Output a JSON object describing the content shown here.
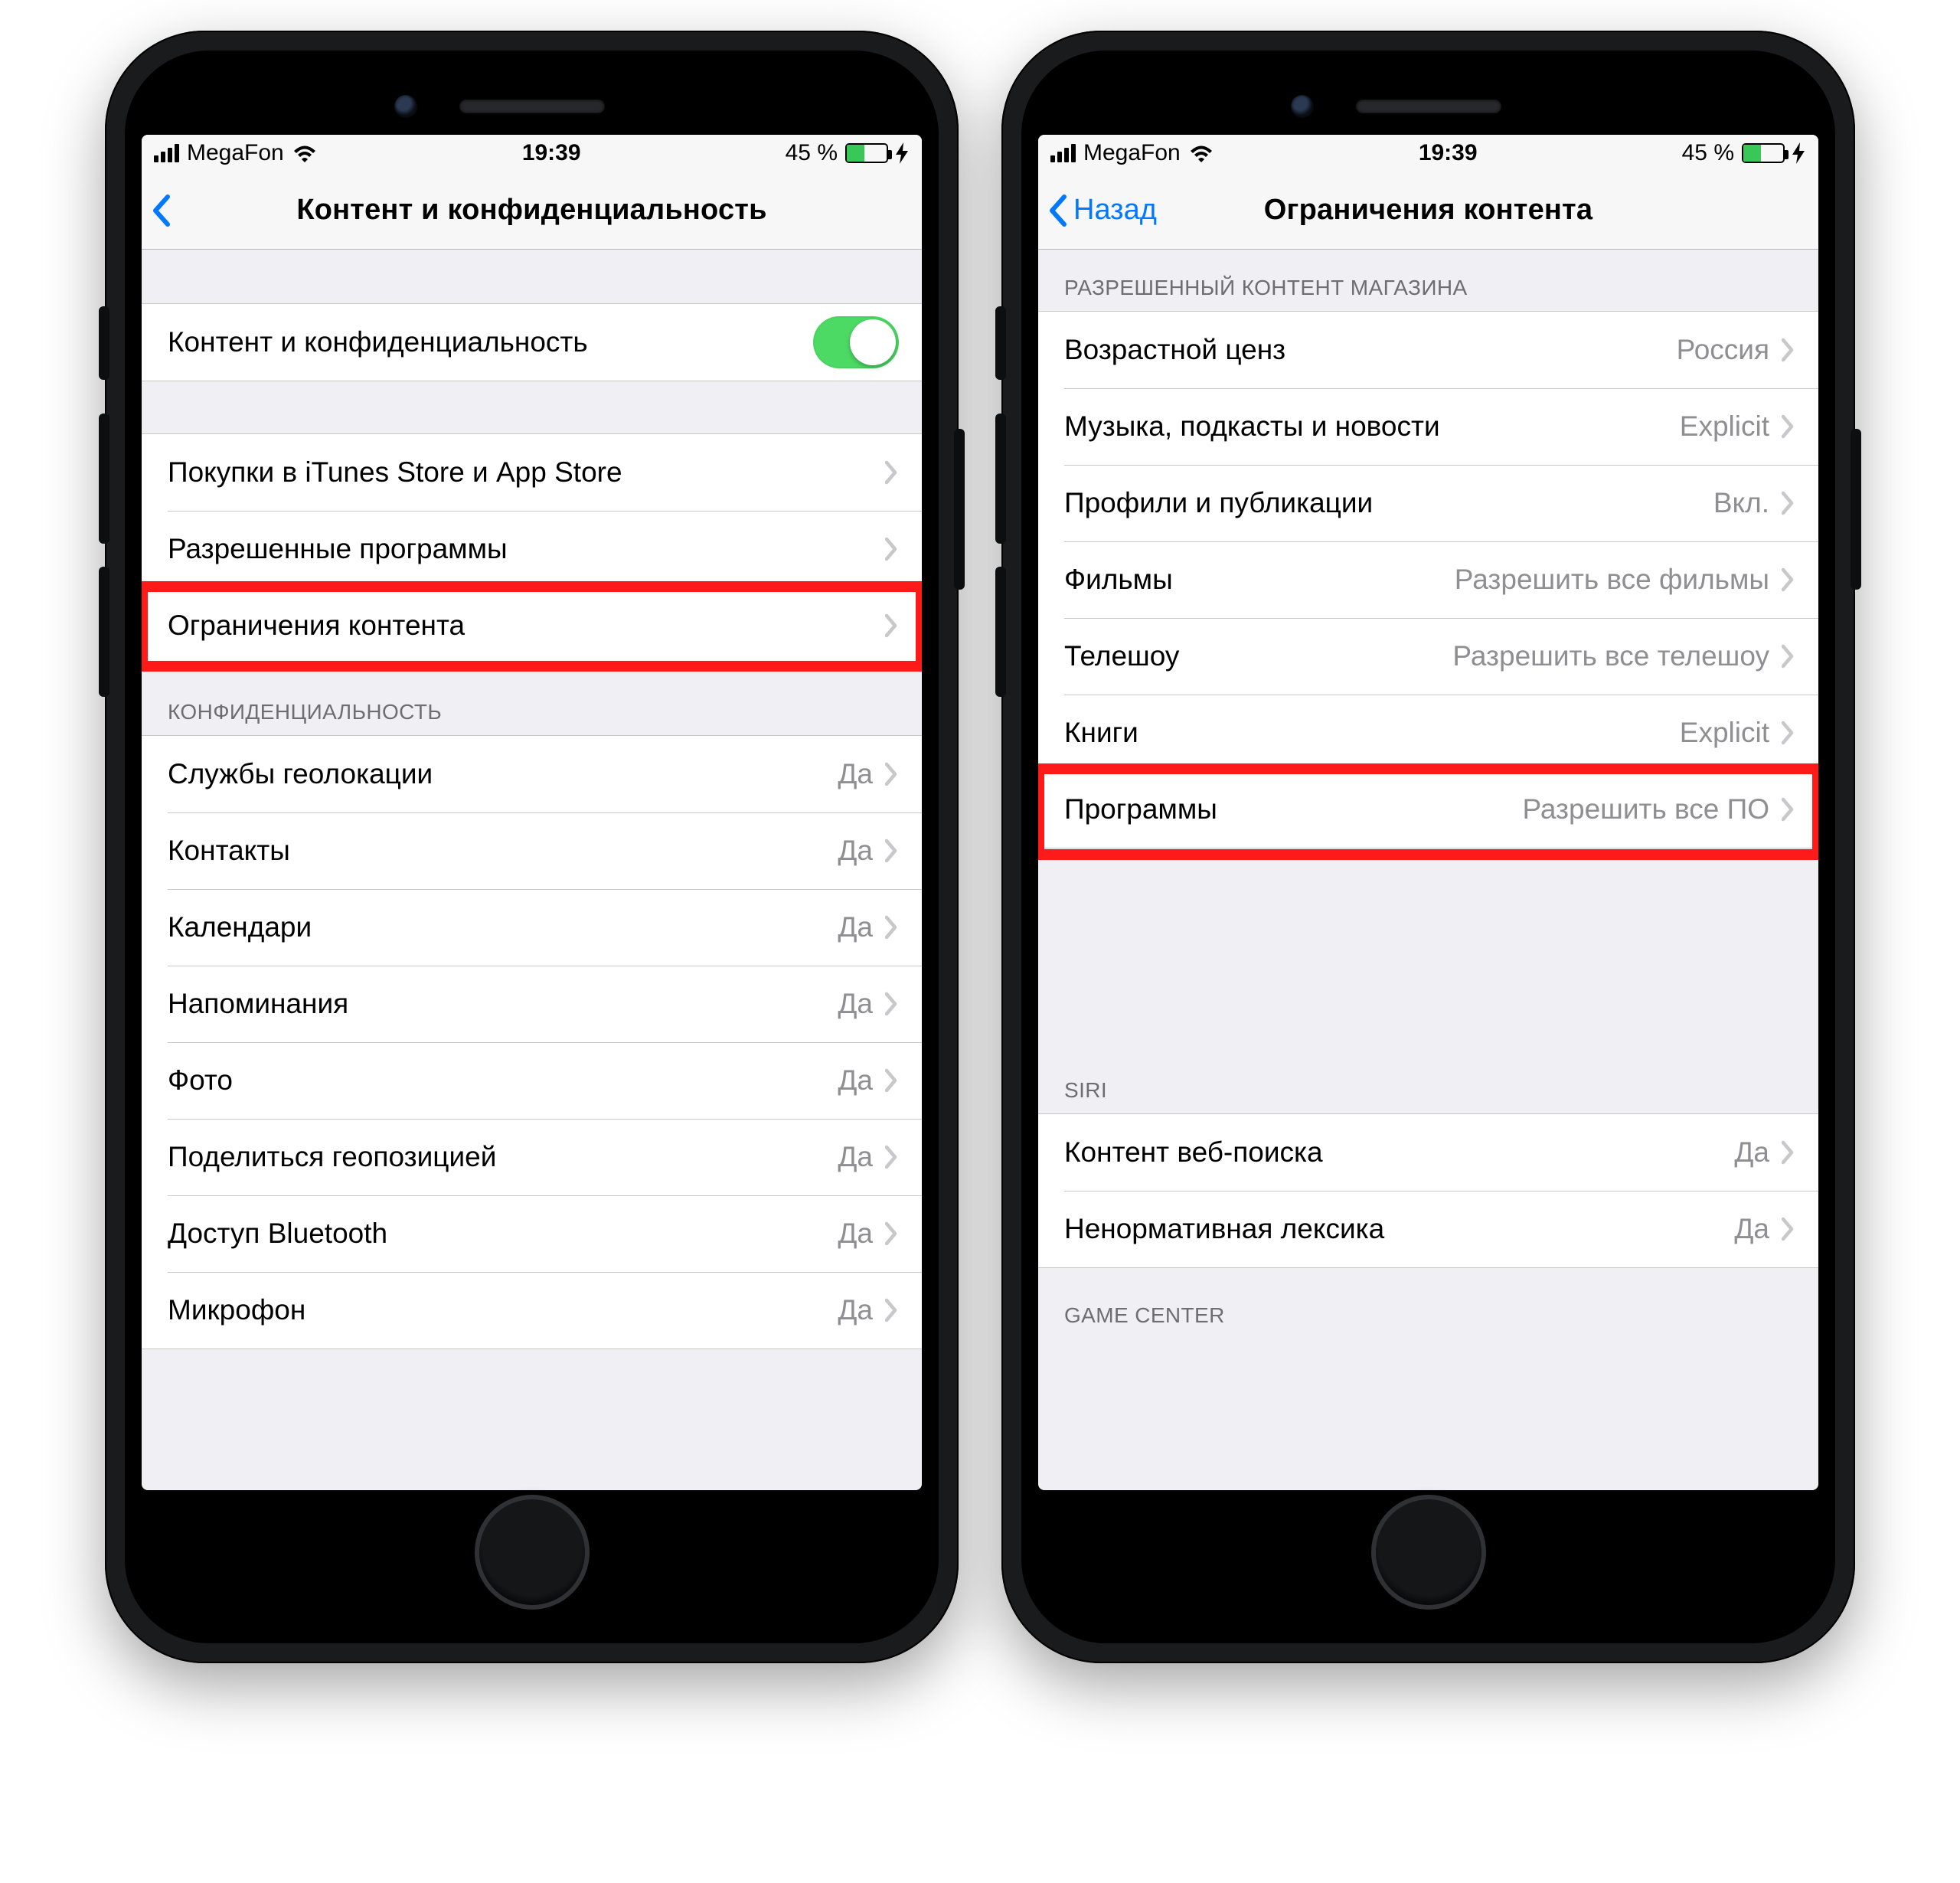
{
  "status": {
    "carrier": "MegaFon",
    "time": "19:39",
    "battery_pct": "45 %"
  },
  "left": {
    "nav_title": "Контент и конфиденциальность",
    "toggle_row": {
      "label": "Контент и конфиденциальность"
    },
    "section1": [
      {
        "label": "Покупки в iTunes Store и App Store"
      },
      {
        "label": "Разрешенные программы"
      },
      {
        "label": "Ограничения контента"
      }
    ],
    "privacy_header": "Конфиденциальность",
    "privacy": [
      {
        "label": "Службы геолокации",
        "value": "Да"
      },
      {
        "label": "Контакты",
        "value": "Да"
      },
      {
        "label": "Календари",
        "value": "Да"
      },
      {
        "label": "Напоминания",
        "value": "Да"
      },
      {
        "label": "Фото",
        "value": "Да"
      },
      {
        "label": "Поделиться геопозицией",
        "value": "Да"
      },
      {
        "label": "Доступ Bluetooth",
        "value": "Да"
      },
      {
        "label": "Микрофон",
        "value": "Да"
      }
    ]
  },
  "right": {
    "nav_back": "Назад",
    "nav_title": "Ограничения контента",
    "store_header": "Разрешенный контент магазина",
    "store": [
      {
        "label": "Возрастной ценз",
        "value": "Россия"
      },
      {
        "label": "Музыка, подкасты и новости",
        "value": "Explicit"
      },
      {
        "label": "Профили и публикации",
        "value": "Вкл."
      },
      {
        "label": "Фильмы",
        "value": "Разрешить все фильмы"
      },
      {
        "label": "Телешоу",
        "value": "Разрешить все телешоу"
      },
      {
        "label": "Книги",
        "value": "Explicit"
      },
      {
        "label": "Программы",
        "value": "Разрешить все ПО"
      }
    ],
    "siri_header": "SIRI",
    "siri": [
      {
        "label": "Контент веб-поиска",
        "value": "Да"
      },
      {
        "label": "Ненормативная лексика",
        "value": "Да"
      }
    ],
    "gc_header": "GAME CENTER"
  }
}
